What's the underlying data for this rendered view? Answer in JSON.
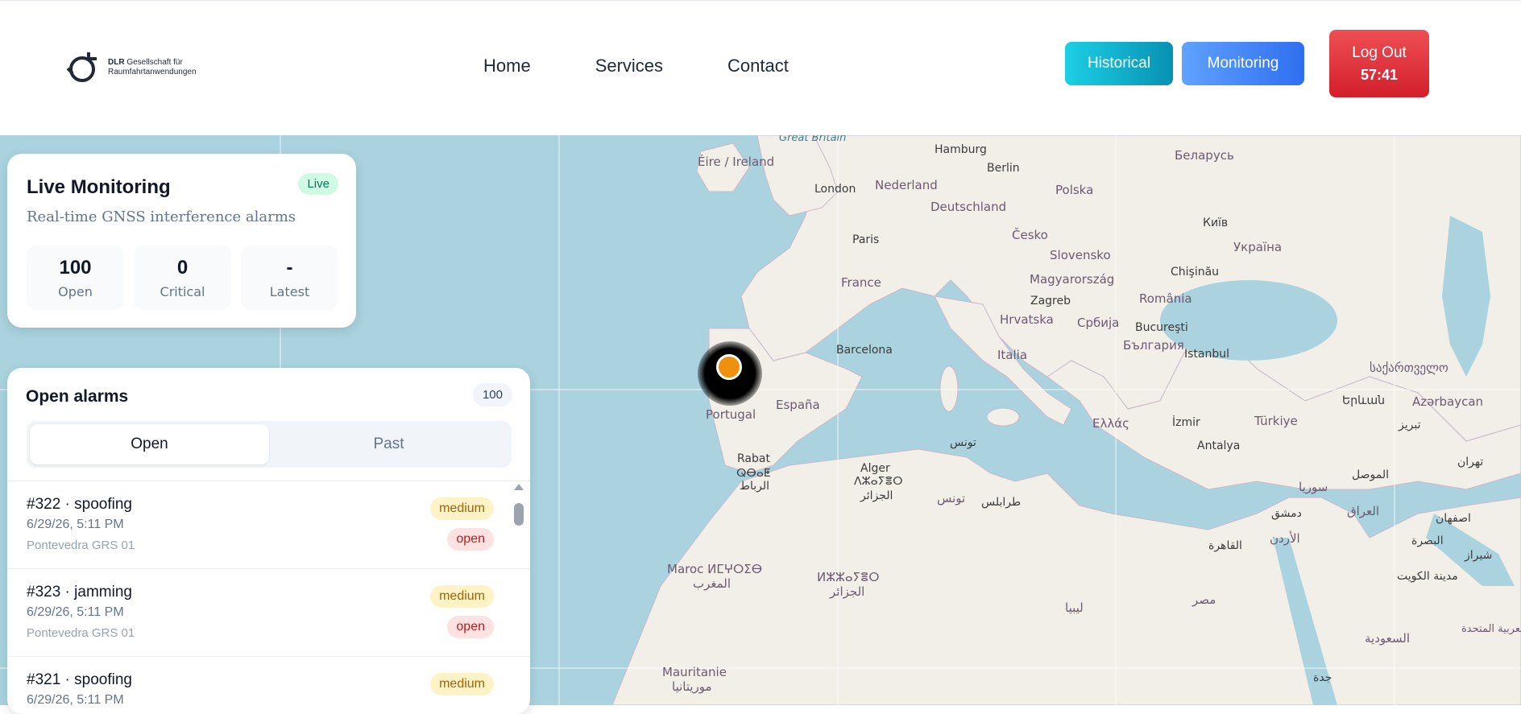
{
  "header": {
    "logo": {
      "line1_bold": "DLR",
      "line1_rest": " Gesellschaft für",
      "line2": "Raumfahrtanwendungen"
    },
    "nav": [
      "Home",
      "Services",
      "Contact"
    ],
    "buttons": {
      "historical": "Historical",
      "monitoring": "Monitoring",
      "logout": "Log Out",
      "timer": "57:41"
    }
  },
  "map": {
    "labels": {
      "great_britain": "Great Britain",
      "eire": "Éire / Ireland",
      "hamburg": "Hamburg",
      "belarus": "Беларусь",
      "berlin": "Berlin",
      "london": "London",
      "nederland": "Nederland",
      "polska": "Polska",
      "deutschland": "Deutschland",
      "kyiv": "Київ",
      "paris": "Paris",
      "cesko": "Česko",
      "ukraina": "Україна",
      "slovensko": "Slovensko",
      "chisinau": "Chişinău",
      "france": "France",
      "magyarorszag": "Magyarország",
      "zagreb": "Zagreb",
      "romania": "România",
      "hrvatska": "Hrvatska",
      "srbija": "Србија",
      "bucuresti": "Bucureşti",
      "barcelona": "Barcelona",
      "bulgaria": "България",
      "italia": "Italia",
      "istanbul": "Istanbul",
      "georgia": "საქართველო",
      "espana": "España",
      "portugal": "Portugal",
      "ellas": "Ελλάς",
      "izmir": "İzmir",
      "turkiye": "Türkiye",
      "yerevan": "Երևան",
      "azerbaycan": "Azərbaycan",
      "tabriz": "تبریز",
      "tunis": "تونس",
      "alger1": "Alger",
      "alger2": "ⴷⵣⴰⵢⴻⵔ",
      "alger3": "الجزائر",
      "rabat1": "Rabat",
      "rabat2": "ⵕⴱⴰⵟ",
      "rabat3": "الرباط",
      "antalya": "Antalya",
      "tunisia": "تونس",
      "tarabulus": "طرابلس",
      "suriya": "سوريا",
      "mosul": "الموصل",
      "tehran": "تهران",
      "dimashq": "دمشق",
      "iraq": "العراق",
      "urdun": "الأردن",
      "isfahan": "اصفهان",
      "qahira": "القاهرة",
      "basra": "البصرة",
      "shiraz": "شیراز",
      "maroc1": "Maroc ⵍⵎⵖⵔⵉⴱ",
      "maroc2": "المغرب",
      "algeria1": "ⵍⵣⵣⴰⵢⴻⵔ",
      "algeria2": "الجزائر",
      "libya": "ليبيا",
      "misr": "مصر",
      "kuwait": "مدينة الكويت",
      "saudi": "السعودية",
      "uae": "الإمارات العربية المتحدة",
      "mauritanie1": "Mauritanie",
      "mauritanie2": "موريتانيا",
      "jeddah": "جدة"
    }
  },
  "live": {
    "title": "Live Monitoring",
    "badge": "Live",
    "subtitle": "Real-time GNSS interference alarms",
    "stats": [
      {
        "value": "100",
        "label": "Open"
      },
      {
        "value": "0",
        "label": "Critical"
      },
      {
        "value": "-",
        "label": "Latest"
      }
    ]
  },
  "alarms": {
    "title": "Open alarms",
    "count": "100",
    "tabs": [
      "Open",
      "Past"
    ],
    "items": [
      {
        "title": "#322 · spoofing",
        "time": "6/29/26, 5:11 PM",
        "site": "Pontevedra GRS 01",
        "severity": "medium",
        "status": "open"
      },
      {
        "title": "#323 · jamming",
        "time": "6/29/26, 5:11 PM",
        "site": "Pontevedra GRS 01",
        "severity": "medium",
        "status": "open"
      },
      {
        "title": "#321 · spoofing",
        "time": "6/29/26, 5:11 PM",
        "site": "",
        "severity": "medium",
        "status": ""
      }
    ]
  },
  "colors": {
    "sea": "#aad3df",
    "land": "#f2efe9",
    "marker": "#f0900f"
  }
}
